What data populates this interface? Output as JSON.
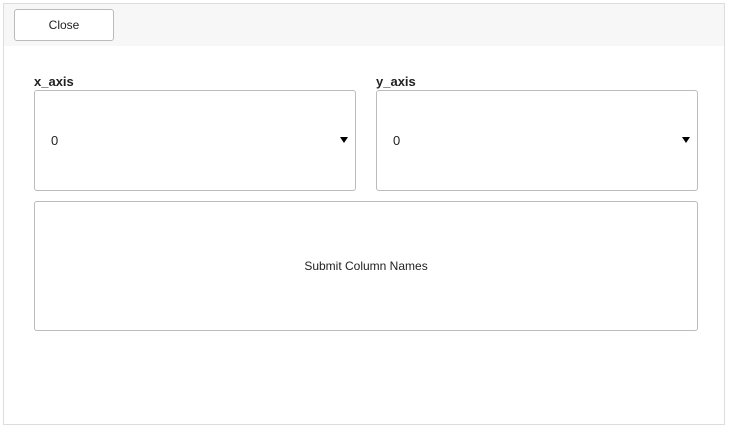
{
  "header": {
    "close_label": "Close"
  },
  "form": {
    "x_axis": {
      "label": "x_axis",
      "selected": "0"
    },
    "y_axis": {
      "label": "y_axis",
      "selected": "0"
    },
    "submit_label": "Submit Column Names"
  },
  "icons": {
    "dropdown": "caret-down-icon"
  }
}
